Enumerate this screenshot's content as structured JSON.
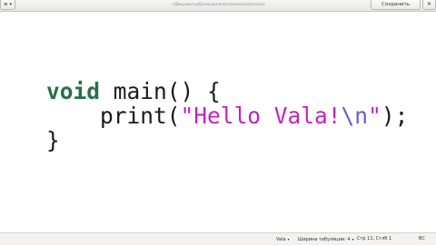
{
  "header": {
    "menu_symbol": "≡",
    "menu_arrow": "▾",
    "subtitle": "~/Документы/Development/vala-lessons/lesson1",
    "save_label": "Сохранить",
    "close_symbol": "✕"
  },
  "editor": {
    "lines": [
      {
        "kw": "void",
        "rest": " main() {"
      },
      {
        "indent": "    ",
        "fn": "print(",
        "str": "\"Hello Vala!",
        "esc": "\\n",
        "str_end": "\"",
        "tail": ");"
      },
      {
        "rest": "}"
      }
    ]
  },
  "statusbar": {
    "language": "Vala",
    "tab_width": "Ширина табуляции: 4",
    "position": "Стр 11, Стлб 1",
    "mode": "ВС",
    "dropdown_arrow": "▾"
  },
  "colors": {
    "keyword": "#26714a",
    "string": "#c71fc2",
    "escape": "#6a5acd"
  }
}
